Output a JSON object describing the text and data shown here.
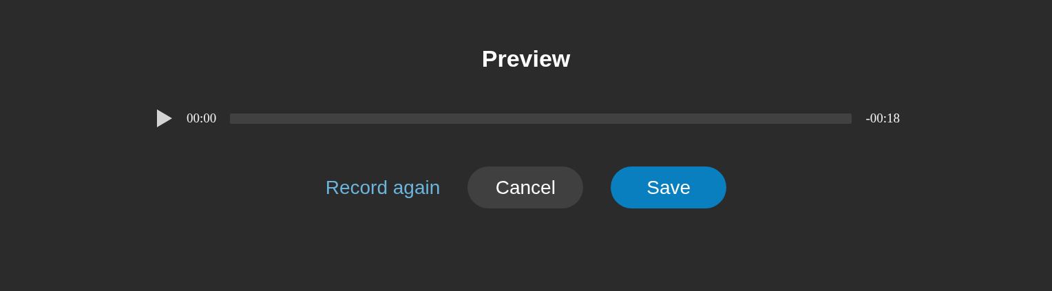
{
  "title": "Preview",
  "player": {
    "elapsed": "00:00",
    "remaining": "-00:18",
    "level": 0
  },
  "actions": [
    {
      "kind": "link",
      "label": "Record again"
    },
    {
      "kind": "secondary",
      "label": "Cancel"
    },
    {
      "kind": "primary",
      "label": "Save"
    }
  ]
}
